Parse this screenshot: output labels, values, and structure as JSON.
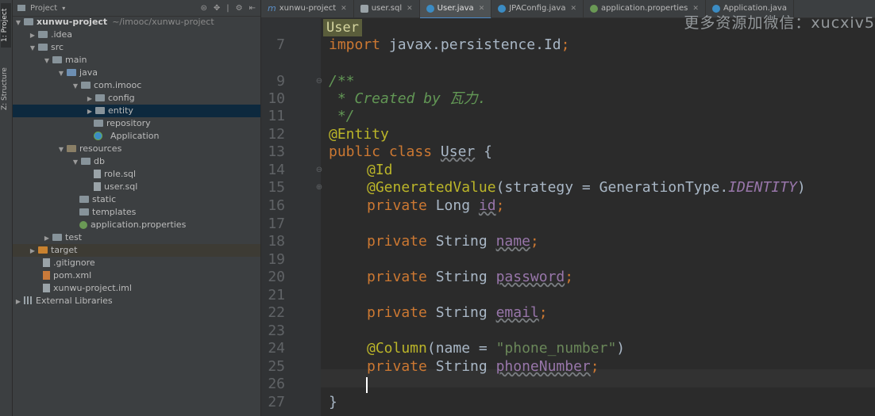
{
  "tool_stripe": {
    "project_tab": "1: Project",
    "structure_tab": "Z: Structure"
  },
  "project_panel": {
    "header": {
      "view_mode": "Project"
    },
    "tree": [
      {
        "label": "xunwu-project",
        "path": "~/imooc/xunwu-project",
        "kind": "root-folder"
      },
      {
        "label": ".idea",
        "kind": "folder"
      },
      {
        "label": "src",
        "kind": "folder"
      },
      {
        "label": "main",
        "kind": "folder"
      },
      {
        "label": "java",
        "kind": "src-folder"
      },
      {
        "label": "com.imooc",
        "kind": "package"
      },
      {
        "label": "config",
        "kind": "package"
      },
      {
        "label": "entity",
        "kind": "package",
        "selected": true
      },
      {
        "label": "repository",
        "kind": "package"
      },
      {
        "label": "Application",
        "kind": "spring-class"
      },
      {
        "label": "resources",
        "kind": "res-folder"
      },
      {
        "label": "db",
        "kind": "folder"
      },
      {
        "label": "role.sql",
        "kind": "file"
      },
      {
        "label": "user.sql",
        "kind": "file"
      },
      {
        "label": "static",
        "kind": "folder"
      },
      {
        "label": "templates",
        "kind": "folder"
      },
      {
        "label": "application.properties",
        "kind": "properties"
      },
      {
        "label": "test",
        "kind": "folder"
      },
      {
        "label": "target",
        "kind": "excluded-folder"
      },
      {
        "label": ".gitignore",
        "kind": "file"
      },
      {
        "label": "pom.xml",
        "kind": "xml"
      },
      {
        "label": "xunwu-project.iml",
        "kind": "file"
      },
      {
        "label": "External Libraries",
        "kind": "library"
      }
    ]
  },
  "tabs": [
    {
      "label": "xunwu-project",
      "icon": "maven-icon",
      "color": "#5b8fc7"
    },
    {
      "label": "user.sql",
      "icon": "sql-file-icon",
      "color": "#9aa3a8"
    },
    {
      "label": "User.java",
      "icon": "class-icon",
      "color": "#3b8cc4",
      "active": true
    },
    {
      "label": "JPAConfig.java",
      "icon": "class-icon",
      "color": "#3b8cc4"
    },
    {
      "label": "application.properties",
      "icon": "properties-icon",
      "color": "#6a9955"
    },
    {
      "label": "Application.java",
      "icon": "spring-class-icon",
      "color": "#3b8cc4"
    }
  ],
  "watermark": "更多资源加微信：xucxiv5",
  "editor": {
    "breadcrumb": "User",
    "line_numbers": [
      "7",
      "9",
      "10",
      "11",
      "12",
      "13",
      "14",
      "15",
      "16",
      "17",
      "18",
      "19",
      "20",
      "21",
      "22",
      "23",
      "24",
      "25",
      "26",
      "27"
    ],
    "code": {
      "l7": [
        "import",
        " javax.persistence.",
        "Id",
        ";"
      ],
      "l9": "/**",
      "l10": " * Created by 瓦力.",
      "l11": " */",
      "l12": "@Entity",
      "l13": [
        "public",
        " ",
        "class",
        " ",
        "User",
        " {"
      ],
      "l14": "@Id",
      "l15": [
        "@GeneratedValue",
        "(strategy = GenerationType.",
        "IDENTITY",
        ")"
      ],
      "l16": [
        "private",
        " Long ",
        "id",
        ";"
      ],
      "l18": [
        "private",
        " String ",
        "name",
        ";"
      ],
      "l20": [
        "private",
        " String ",
        "password",
        ";"
      ],
      "l22": [
        "private",
        " String ",
        "email",
        ";"
      ],
      "l24": [
        "@Column",
        "(name = ",
        "\"phone_number\"",
        ")"
      ],
      "l25": [
        "private",
        " String ",
        "phoneNumber",
        ";"
      ],
      "l27": "}"
    }
  },
  "colors": {
    "keyword": "#cc7832",
    "annotation": "#bbb529",
    "doc_comment": "#629755",
    "string": "#6a8759",
    "field": "#9876aa",
    "default_text": "#a9b7c6",
    "accent": "#4a88c7"
  }
}
